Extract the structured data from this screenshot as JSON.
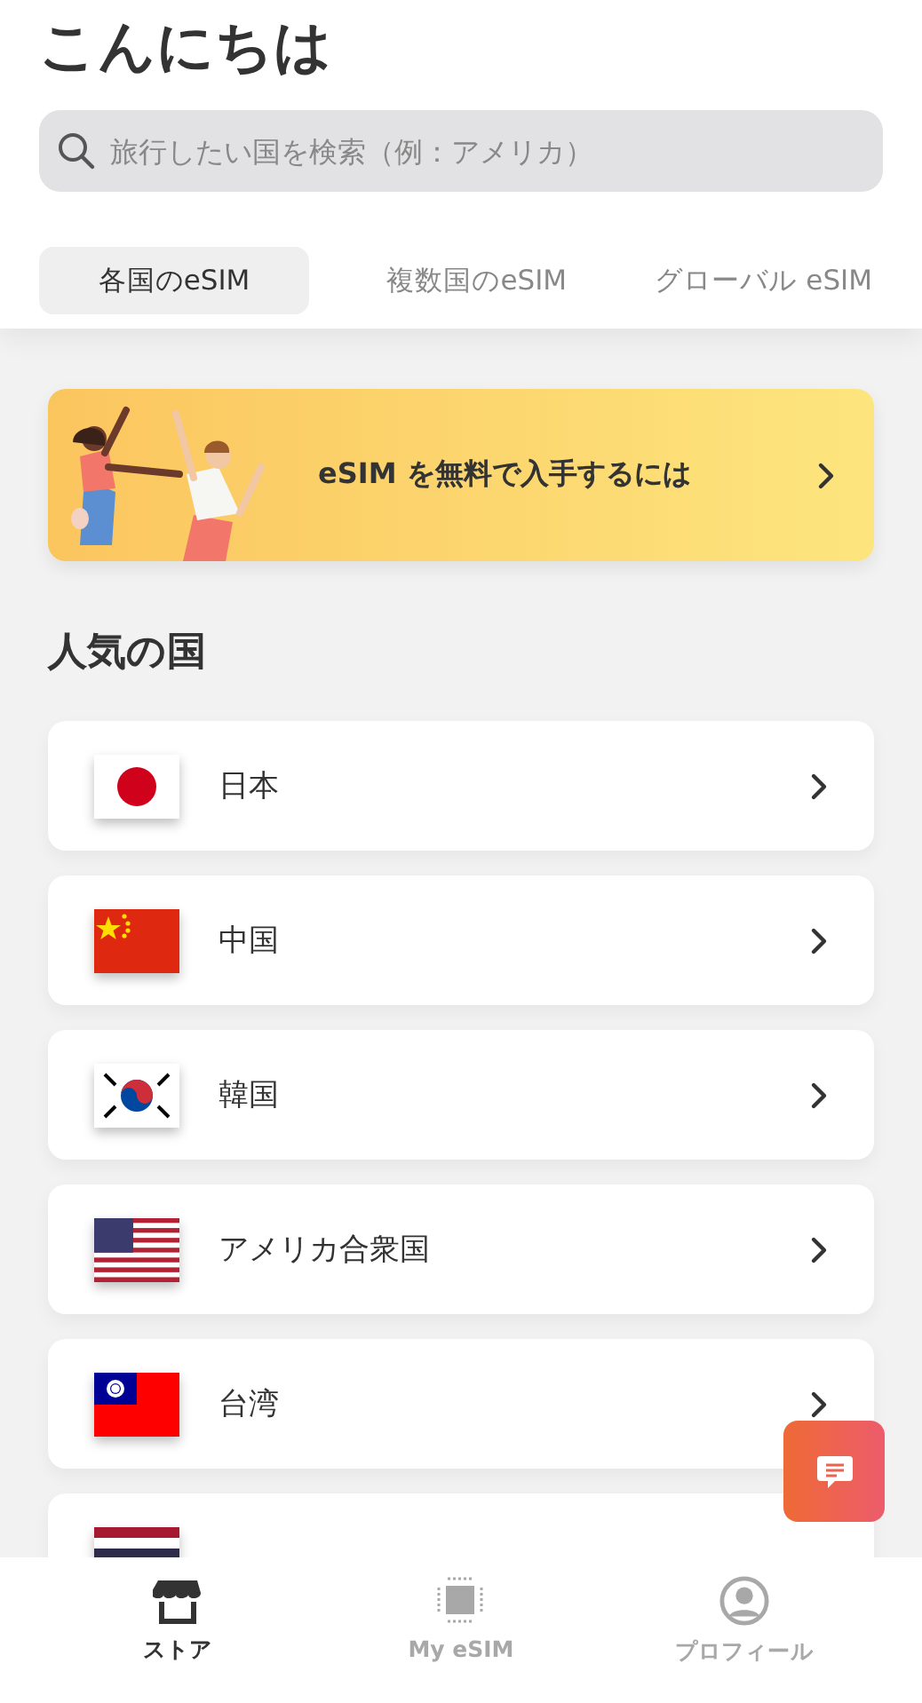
{
  "header": {
    "title": "こんにちは"
  },
  "search": {
    "placeholder": "旅行したい国を検索（例：アメリカ）"
  },
  "tabs": [
    {
      "label": "各国のeSIM",
      "selected": true
    },
    {
      "label": "複数国のeSIM",
      "selected": false
    },
    {
      "label": "グローバル eSIM",
      "selected": false
    }
  ],
  "banner": {
    "text": "eSIM を無料で入手するには"
  },
  "section_title": "人気の国",
  "countries": [
    {
      "name": "日本",
      "kind": "japan"
    },
    {
      "name": "中国",
      "kind": "china"
    },
    {
      "name": "韓国",
      "kind": "korea"
    },
    {
      "name": "アメリカ合衆国",
      "kind": "usa"
    },
    {
      "name": "台湾",
      "kind": "taiwan"
    },
    {
      "kind": "thailand"
    }
  ],
  "bottom_nav": [
    {
      "label": "ストア",
      "kind": "store",
      "selected": true
    },
    {
      "label": "My eSIM",
      "kind": "chip",
      "selected": false
    },
    {
      "label": "プロフィール",
      "kind": "profile",
      "selected": false
    }
  ]
}
